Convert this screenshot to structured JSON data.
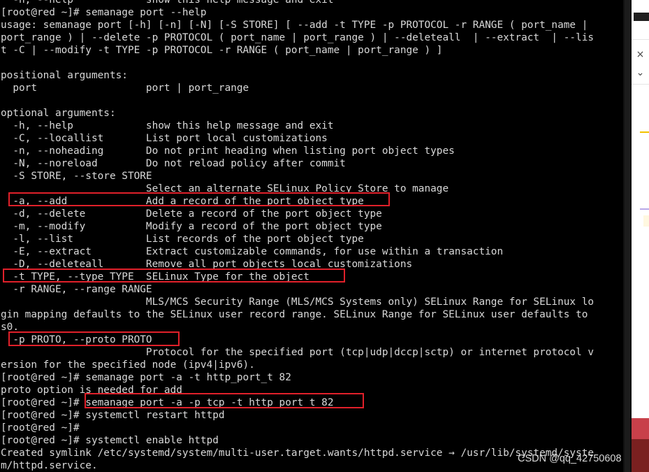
{
  "terminal": {
    "lines": [
      "  -h, --help            show this help message and exit",
      "[root@red ~]# semanage port --help",
      "usage: semanage port [-h] [-n] [-N] [-S STORE] [ --add -t TYPE -p PROTOCOL -r RANGE ( port_name |",
      "port_range ) | --delete -p PROTOCOL ( port_name | port_range ) | --deleteall  | --extract  | --lis",
      "t -C | --modify -t TYPE -p PROTOCOL -r RANGE ( port_name | port_range ) ]",
      "",
      "positional arguments:",
      "  port                  port | port_range",
      "",
      "optional arguments:",
      "  -h, --help            show this help message and exit",
      "  -C, --locallist       List port local customizations",
      "  -n, --noheading       Do not print heading when listing port object types",
      "  -N, --noreload        Do not reload policy after commit",
      "  -S STORE, --store STORE",
      "                        Select an alternate SELinux Policy Store to manage",
      "  -a, --add             Add a record of the port object type",
      "  -d, --delete          Delete a record of the port object type",
      "  -m, --modify          Modify a record of the port object type",
      "  -l, --list            List records of the port object type",
      "  -E, --extract         Extract customizable commands, for use within a transaction",
      "  -D, --deleteall       Remove all port objects local customizations",
      "  -t TYPE, --type TYPE  SELinux Type for the object",
      "  -r RANGE, --range RANGE",
      "                        MLS/MCS Security Range (MLS/MCS Systems only) SELinux Range for SELinux lo",
      "gin mapping defaults to the SELinux user record range. SELinux Range for SELinux user defaults to",
      "s0.",
      "  -p PROTO, --proto PROTO",
      "                        Protocol for the specified port (tcp|udp|dccp|sctp) or internet protocol v",
      "ersion for the specified node (ipv4|ipv6).",
      "[root@red ~]# semanage port -a -t http_port_t 82",
      "proto option is needed for add",
      "[root@red ~]# semanage port -a -p tcp -t http_port_t 82",
      "[root@red ~]# systemctl restart httpd",
      "[root@red ~]#",
      "[root@red ~]# systemctl enable httpd",
      "Created symlink /etc/systemd/system/multi-user.target.wants/httpd.service → /usr/lib/systemd/syste",
      "m/httpd.service."
    ]
  },
  "sidebar": {
    "icons": [
      "close-icon",
      "chevron-down-icon"
    ],
    "close_glyph": "×",
    "chevron_glyph": "⌄"
  },
  "watermark": "CSDN @qq_42750608",
  "colors": {
    "terminal_bg": "#000000",
    "terminal_fg": "#d8d8d8",
    "highlight": "#e0202a"
  }
}
